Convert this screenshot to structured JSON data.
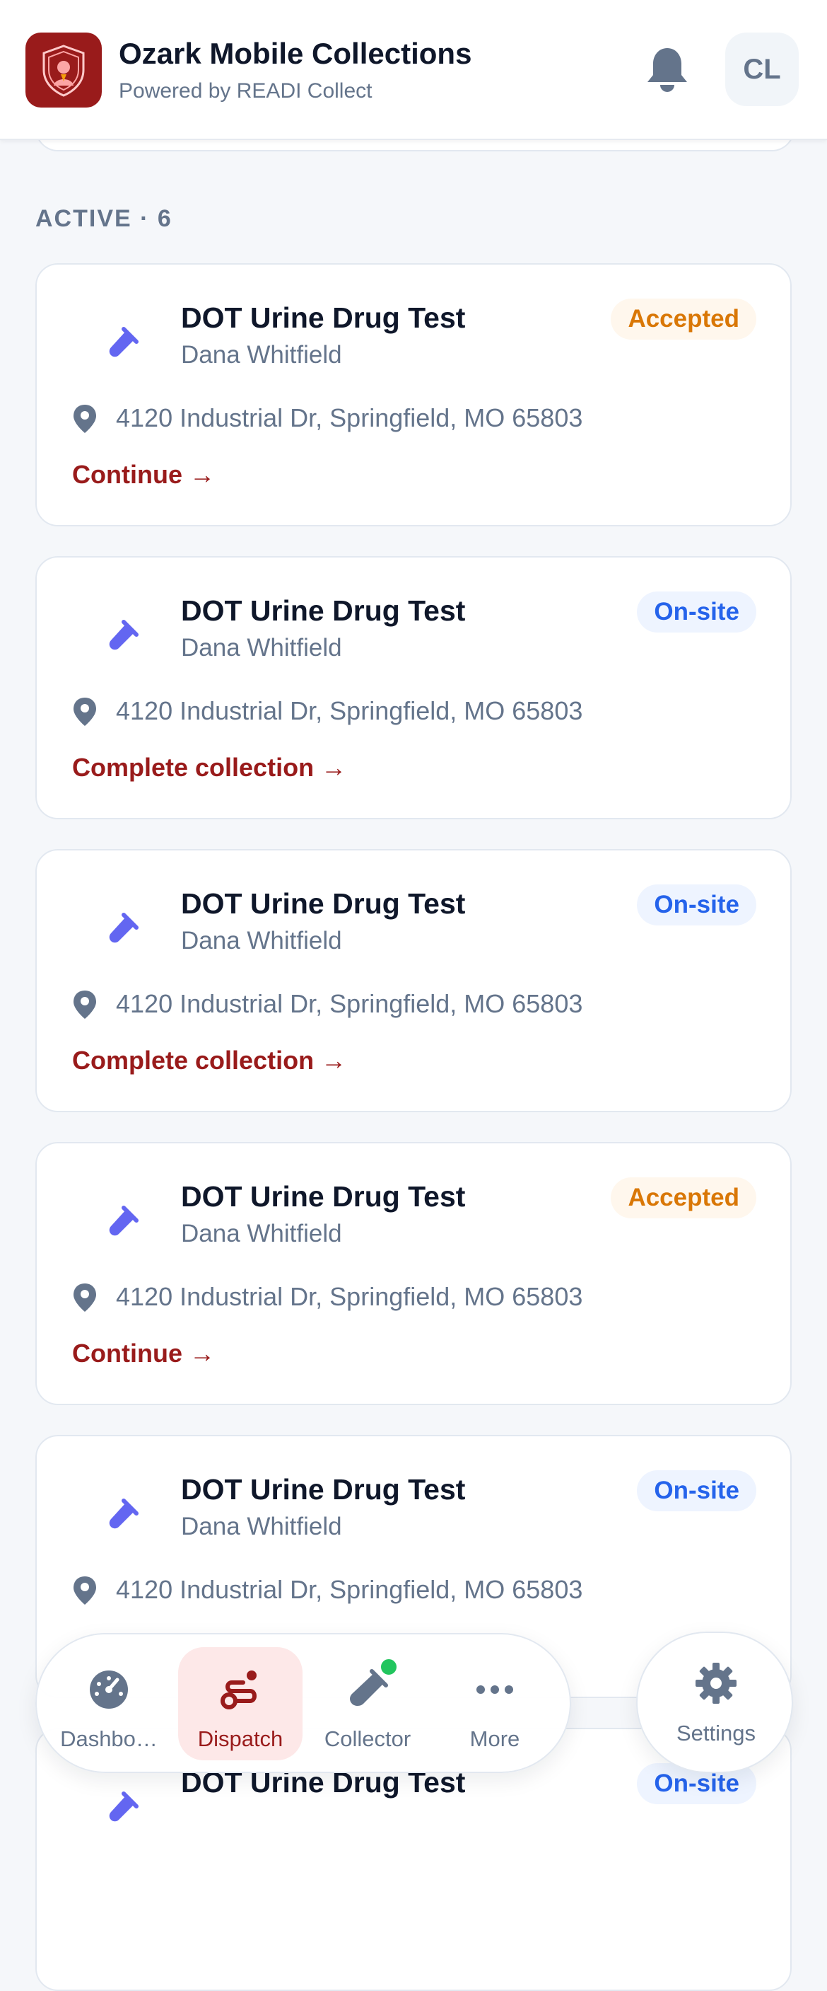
{
  "header": {
    "app_title": "Ozark Mobile Collections",
    "app_subtitle": "Powered by READI Collect",
    "avatar_initials": "CL",
    "brand_color": "#991b1b"
  },
  "section": {
    "label": "ACTIVE · 6"
  },
  "jobs": [
    {
      "title": "DOT Urine Drug Test",
      "person": "Dana Whitfield",
      "status": "Accepted",
      "address": "4120 Industrial Dr, Springfield, MO 65803",
      "action": "Continue →"
    },
    {
      "title": "DOT Urine Drug Test",
      "person": "Dana Whitfield",
      "status": "On-site",
      "address": "4120 Industrial Dr, Springfield, MO 65803",
      "action": "Complete collection →"
    },
    {
      "title": "DOT Urine Drug Test",
      "person": "Dana Whitfield",
      "status": "On-site",
      "address": "4120 Industrial Dr, Springfield, MO 65803",
      "action": "Complete collection →"
    },
    {
      "title": "DOT Urine Drug Test",
      "person": "Dana Whitfield",
      "status": "Accepted",
      "address": "4120 Industrial Dr, Springfield, MO 65803",
      "action": "Continue →"
    },
    {
      "title": "DOT Urine Drug Test",
      "person": "Dana Whitfield",
      "status": "On-site",
      "address": "4120 Industrial Dr, Springfield, MO 65803",
      "action": ""
    },
    {
      "title": "DOT Urine Drug Test",
      "person": "",
      "status": "On-site",
      "address": "",
      "action": ""
    }
  ],
  "nav": {
    "items": [
      {
        "label": "Dashbo…",
        "icon": "gauge-icon"
      },
      {
        "label": "Dispatch",
        "icon": "route-icon",
        "active": true
      },
      {
        "label": "Collector",
        "icon": "test-tube-icon",
        "status_dot": true
      },
      {
        "label": "More",
        "icon": "more-dots-icon"
      }
    ],
    "settings_label": "Settings"
  },
  "colors": {
    "accepted": "#d97706",
    "onsite": "#2563eb",
    "tube": "#6366f1",
    "online": "#22c55e"
  }
}
